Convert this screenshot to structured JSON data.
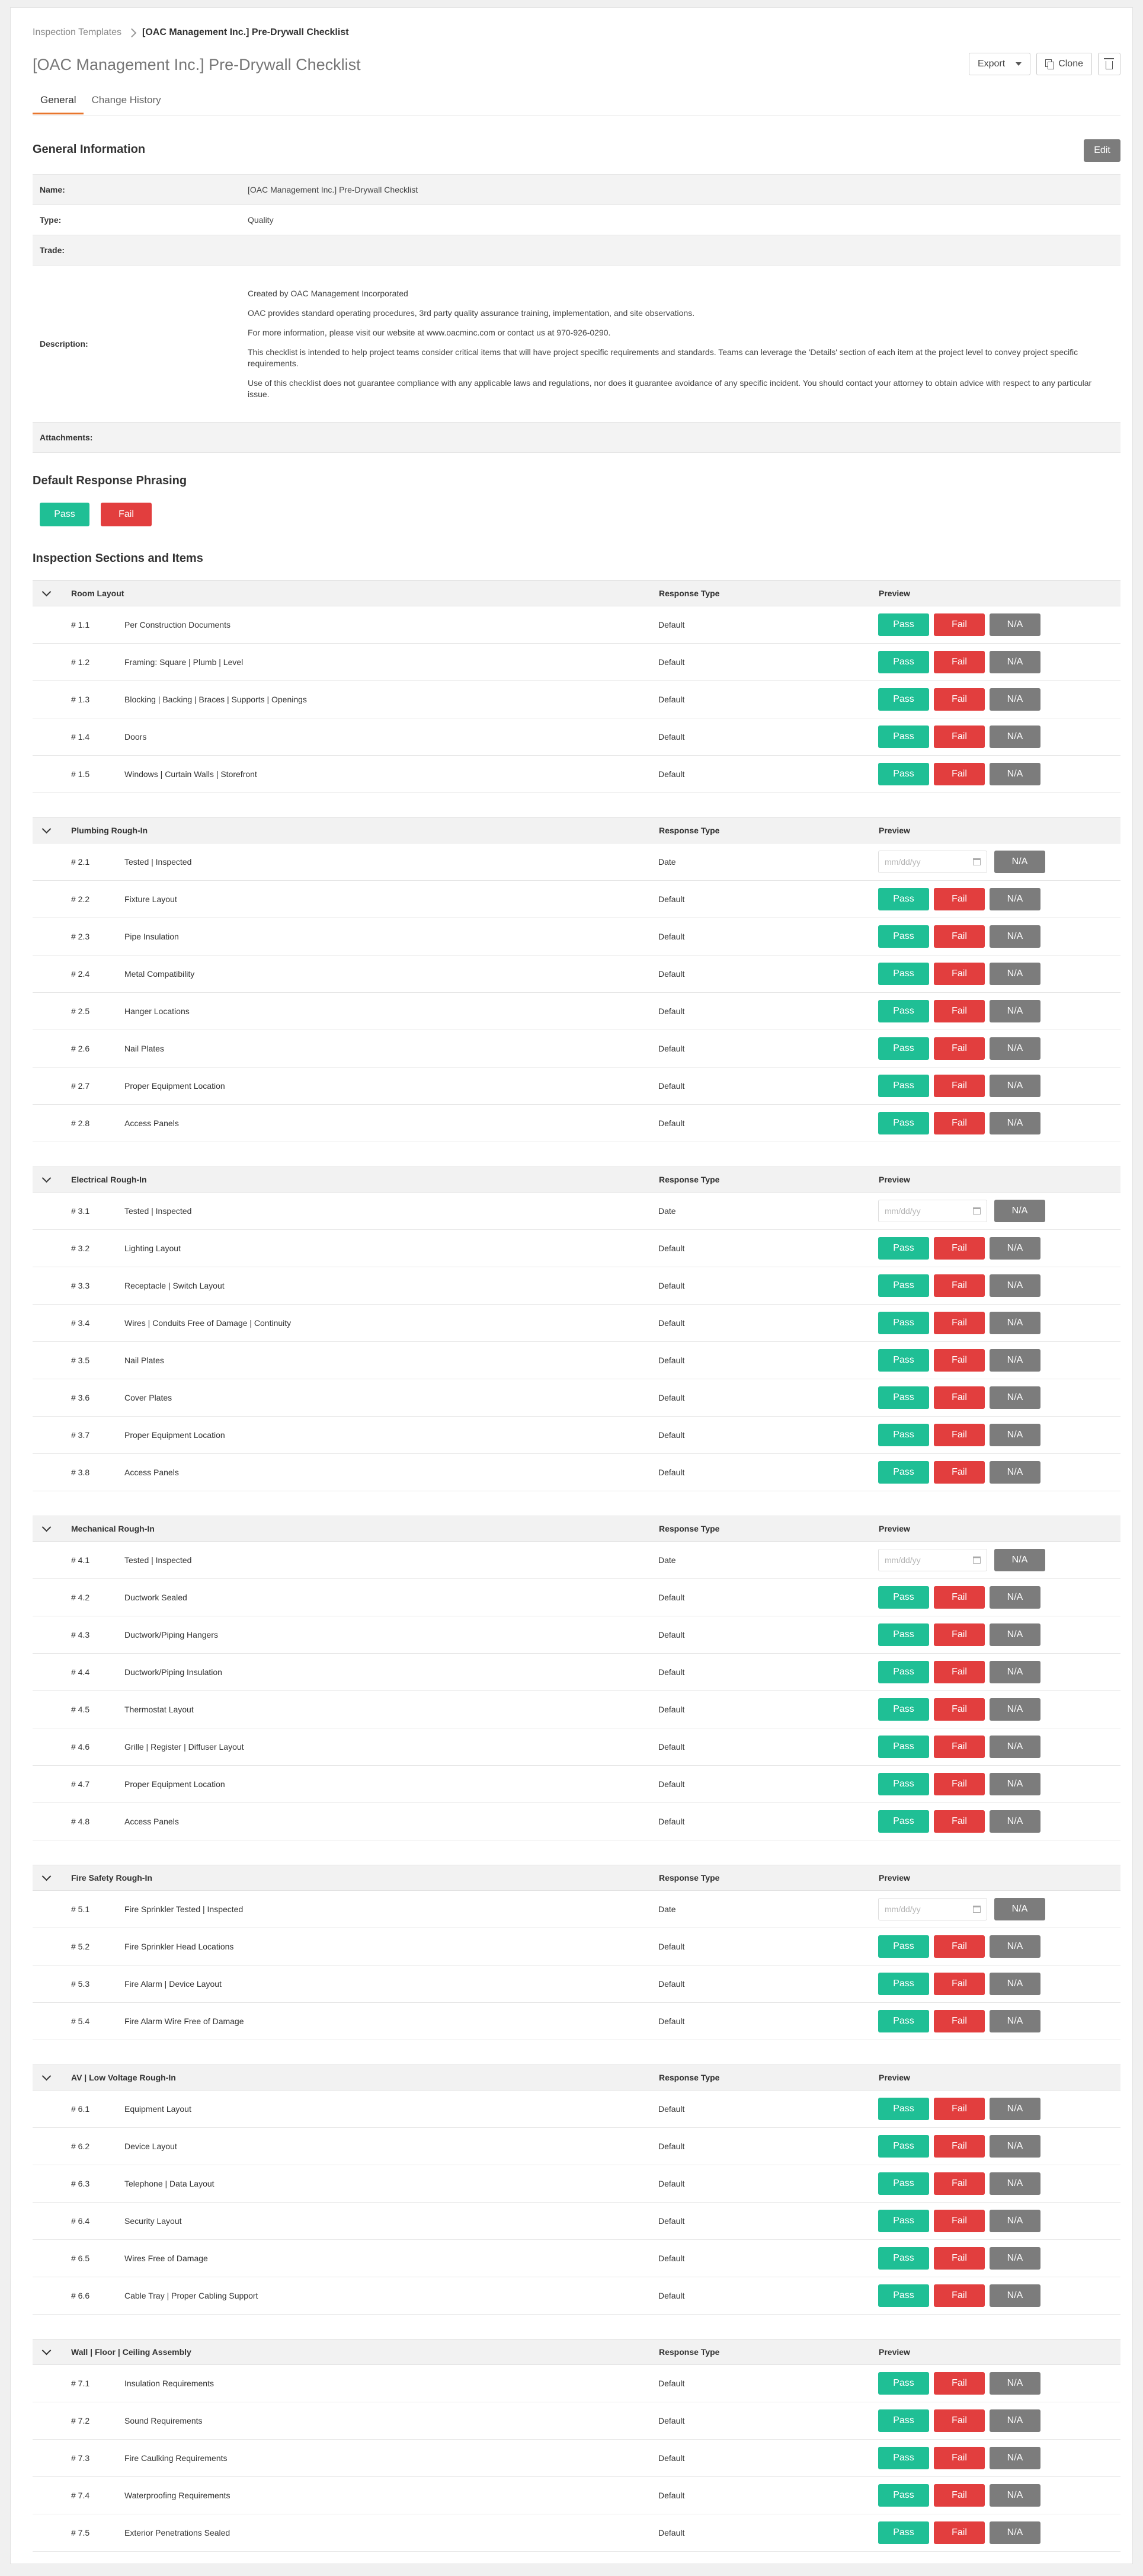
{
  "breadcrumb": {
    "parent": "Inspection Templates",
    "current": "[OAC Management Inc.] Pre-Drywall Checklist"
  },
  "title": "[OAC Management Inc.] Pre-Drywall Checklist",
  "actions": {
    "export": "Export",
    "clone": "Clone"
  },
  "tabs": [
    "General",
    "Change History"
  ],
  "general": {
    "heading": "General Information",
    "edit": "Edit",
    "name_label": "Name:",
    "name_value": "[OAC Management Inc.] Pre-Drywall Checklist",
    "type_label": "Type:",
    "type_value": "Quality",
    "trade_label": "Trade:",
    "trade_value": "",
    "description_label": "Description:",
    "description": [
      "Created by OAC Management Incorporated",
      "OAC provides standard operating procedures, 3rd party quality assurance training, implementation, and site observations.",
      "For more information, please visit our website at www.oacminc.com or contact us at 970-926-0290.",
      "This checklist is intended to help project teams consider critical items that will have project specific requirements and standards. Teams can leverage the 'Details' section of each item at the project level to convey project specific requirements.",
      "Use of this checklist does not guarantee compliance with any applicable laws and regulations, nor does it guarantee avoidance of any specific incident. You should contact your attorney to obtain advice with respect to any particular issue."
    ],
    "attachments_label": "Attachments:"
  },
  "phrasing": {
    "heading": "Default Response Phrasing",
    "pass": "Pass",
    "fail": "Fail"
  },
  "inspection": {
    "heading": "Inspection Sections and Items",
    "col_response": "Response Type",
    "col_preview": "Preview",
    "btn_pass": "Pass",
    "btn_fail": "Fail",
    "btn_na": "N/A",
    "date_placeholder": "mm/dd/yy",
    "sections": [
      {
        "name": "Room Layout",
        "items": [
          {
            "num": "# 1.1",
            "label": "Per Construction Documents",
            "type": "Default"
          },
          {
            "num": "# 1.2",
            "label": "Framing: Square | Plumb | Level",
            "type": "Default"
          },
          {
            "num": "# 1.3",
            "label": "Blocking | Backing | Braces | Supports | Openings",
            "type": "Default"
          },
          {
            "num": "# 1.4",
            "label": "Doors",
            "type": "Default"
          },
          {
            "num": "# 1.5",
            "label": "Windows | Curtain Walls | Storefront",
            "type": "Default"
          }
        ]
      },
      {
        "name": "Plumbing Rough-In",
        "items": [
          {
            "num": "# 2.1",
            "label": "Tested | Inspected",
            "type": "Date"
          },
          {
            "num": "# 2.2",
            "label": "Fixture Layout",
            "type": "Default"
          },
          {
            "num": "# 2.3",
            "label": "Pipe Insulation",
            "type": "Default"
          },
          {
            "num": "# 2.4",
            "label": "Metal Compatibility",
            "type": "Default"
          },
          {
            "num": "# 2.5",
            "label": "Hanger Locations",
            "type": "Default"
          },
          {
            "num": "# 2.6",
            "label": "Nail Plates",
            "type": "Default"
          },
          {
            "num": "# 2.7",
            "label": "Proper Equipment Location",
            "type": "Default"
          },
          {
            "num": "# 2.8",
            "label": "Access Panels",
            "type": "Default"
          }
        ]
      },
      {
        "name": "Electrical Rough-In",
        "items": [
          {
            "num": "# 3.1",
            "label": "Tested | Inspected",
            "type": "Date"
          },
          {
            "num": "# 3.2",
            "label": "Lighting Layout",
            "type": "Default"
          },
          {
            "num": "# 3.3",
            "label": "Receptacle | Switch Layout",
            "type": "Default"
          },
          {
            "num": "# 3.4",
            "label": "Wires | Conduits Free of Damage | Continuity",
            "type": "Default"
          },
          {
            "num": "# 3.5",
            "label": "Nail Plates",
            "type": "Default"
          },
          {
            "num": "# 3.6",
            "label": "Cover Plates",
            "type": "Default"
          },
          {
            "num": "# 3.7",
            "label": "Proper Equipment Location",
            "type": "Default"
          },
          {
            "num": "# 3.8",
            "label": "Access Panels",
            "type": "Default"
          }
        ]
      },
      {
        "name": "Mechanical Rough-In",
        "items": [
          {
            "num": "# 4.1",
            "label": "Tested | Inspected",
            "type": "Date"
          },
          {
            "num": "# 4.2",
            "label": "Ductwork Sealed",
            "type": "Default"
          },
          {
            "num": "# 4.3",
            "label": "Ductwork/Piping Hangers",
            "type": "Default"
          },
          {
            "num": "# 4.4",
            "label": "Ductwork/Piping Insulation",
            "type": "Default"
          },
          {
            "num": "# 4.5",
            "label": "Thermostat Layout",
            "type": "Default"
          },
          {
            "num": "# 4.6",
            "label": "Grille | Register | Diffuser Layout",
            "type": "Default"
          },
          {
            "num": "# 4.7",
            "label": "Proper Equipment Location",
            "type": "Default"
          },
          {
            "num": "# 4.8",
            "label": "Access Panels",
            "type": "Default"
          }
        ]
      },
      {
        "name": "Fire Safety Rough-In",
        "items": [
          {
            "num": "# 5.1",
            "label": "Fire Sprinkler Tested | Inspected",
            "type": "Date"
          },
          {
            "num": "# 5.2",
            "label": "Fire Sprinkler Head Locations",
            "type": "Default"
          },
          {
            "num": "# 5.3",
            "label": "Fire Alarm | Device Layout",
            "type": "Default"
          },
          {
            "num": "# 5.4",
            "label": "Fire Alarm Wire Free of Damage",
            "type": "Default"
          }
        ]
      },
      {
        "name": "AV | Low Voltage Rough-In",
        "items": [
          {
            "num": "# 6.1",
            "label": "Equipment Layout",
            "type": "Default"
          },
          {
            "num": "# 6.2",
            "label": "Device Layout",
            "type": "Default"
          },
          {
            "num": "# 6.3",
            "label": "Telephone | Data Layout",
            "type": "Default"
          },
          {
            "num": "# 6.4",
            "label": "Security Layout",
            "type": "Default"
          },
          {
            "num": "# 6.5",
            "label": "Wires Free of Damage",
            "type": "Default"
          },
          {
            "num": "# 6.6",
            "label": "Cable Tray | Proper Cabling Support",
            "type": "Default"
          }
        ]
      },
      {
        "name": "Wall | Floor | Ceiling Assembly",
        "items": [
          {
            "num": "# 7.1",
            "label": "Insulation Requirements",
            "type": "Default"
          },
          {
            "num": "# 7.2",
            "label": "Sound Requirements",
            "type": "Default"
          },
          {
            "num": "# 7.3",
            "label": "Fire Caulking Requirements",
            "type": "Default"
          },
          {
            "num": "# 7.4",
            "label": "Waterproofing Requirements",
            "type": "Default"
          },
          {
            "num": "# 7.5",
            "label": "Exterior Penetrations Sealed",
            "type": "Default"
          }
        ]
      }
    ]
  }
}
